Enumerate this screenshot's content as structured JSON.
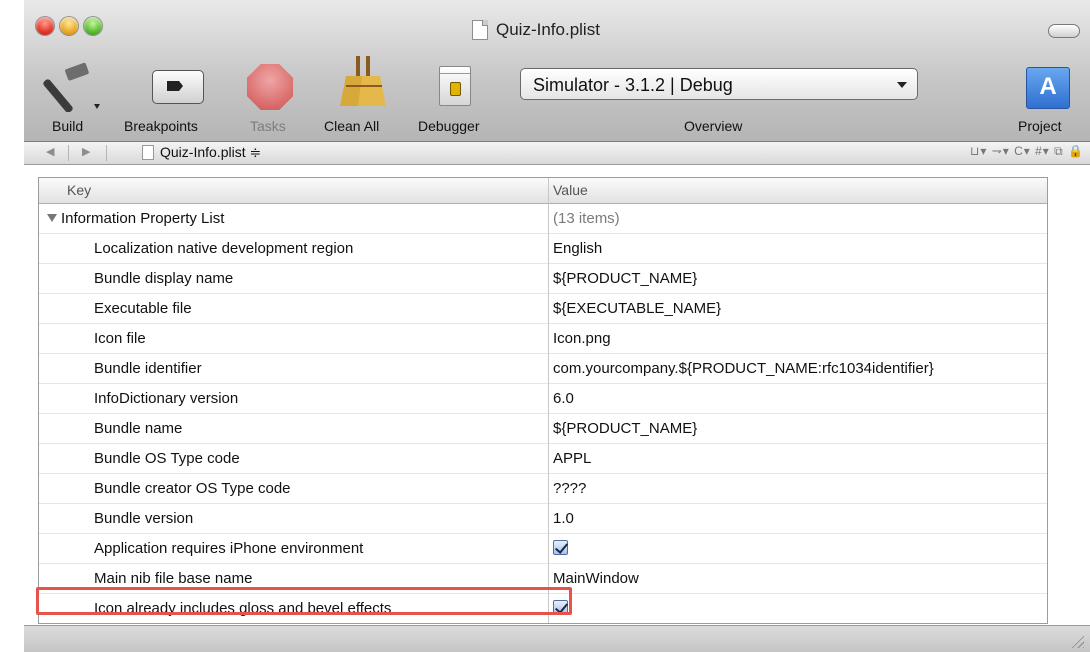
{
  "window": {
    "title": "Quiz-Info.plist"
  },
  "toolbar": {
    "build_label": "Build",
    "breakpoints_label": "Breakpoints",
    "tasks_label": "Tasks",
    "clean_all_label": "Clean All",
    "debugger_label": "Debugger",
    "overview_value": "Simulator - 3.1.2 | Debug",
    "overview_label": "Overview",
    "project_label": "Project"
  },
  "navbar": {
    "file": "Quiz-Info.plist ≑",
    "right_controls": "⊔▾ ⇁▾ C▾ #▾ ⧉ 🔒"
  },
  "table": {
    "headers": {
      "key": "Key",
      "value": "Value"
    },
    "root": {
      "key": "Information Property List",
      "value": "(13 items)"
    },
    "rows": [
      {
        "key": "Localization native development region",
        "value": "English"
      },
      {
        "key": "Bundle display name",
        "value": "${PRODUCT_NAME}"
      },
      {
        "key": "Executable file",
        "value": "${EXECUTABLE_NAME}"
      },
      {
        "key": "Icon file",
        "value": "Icon.png"
      },
      {
        "key": "Bundle identifier",
        "value": "com.yourcompany.${PRODUCT_NAME:rfc1034identifier}"
      },
      {
        "key": "InfoDictionary version",
        "value": "6.0"
      },
      {
        "key": "Bundle name",
        "value": "${PRODUCT_NAME}"
      },
      {
        "key": "Bundle OS Type code",
        "value": "APPL"
      },
      {
        "key": "Bundle creator OS Type code",
        "value": "????"
      },
      {
        "key": "Bundle version",
        "value": "1.0"
      },
      {
        "key": "Application requires iPhone environment",
        "value": "checked"
      },
      {
        "key": "Main nib file base name",
        "value": "MainWindow"
      },
      {
        "key": "Icon already includes gloss and bevel effects",
        "value": "checked"
      }
    ]
  },
  "colors": {
    "highlight": "#e5534b",
    "checkbox": "#a8c1ea"
  }
}
